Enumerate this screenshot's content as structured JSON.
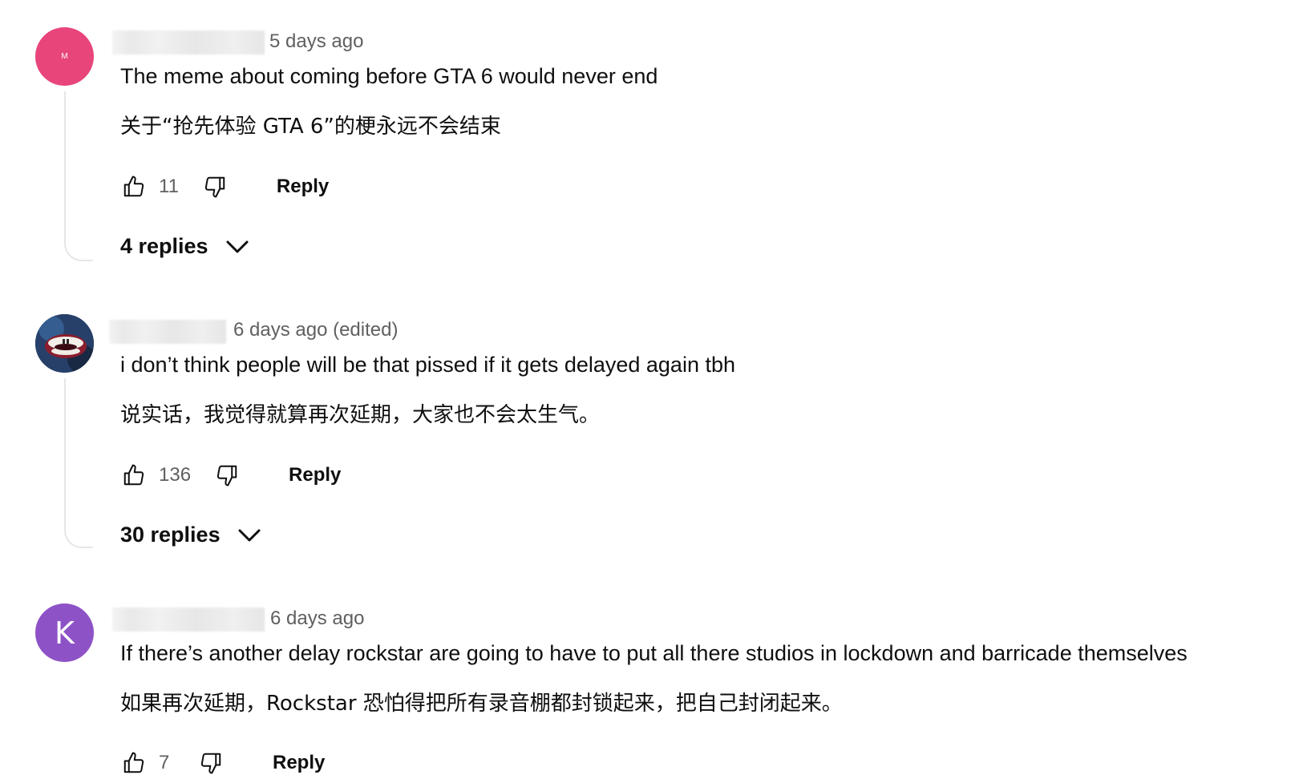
{
  "comments": [
    {
      "avatar_letter": "M",
      "avatar_color": "#e8457b",
      "timestamp": "5 days ago",
      "text": "The meme about coming before GTA 6 would never end",
      "translation": "关于“抢先体验 GTA 6”的梗永远不会结束",
      "likes": "11",
      "reply_label": "Reply",
      "replies_label": "4 replies"
    },
    {
      "avatar_letter": "",
      "avatar_color": "#1f3049",
      "timestamp": "6 days ago (edited)",
      "text": "i don’t think people will be that pissed if it gets delayed again tbh",
      "translation": "说实话，我觉得就算再次延期，大家也不会太生气。",
      "likes": "136",
      "reply_label": "Reply",
      "replies_label": "30 replies"
    },
    {
      "avatar_letter": "K",
      "avatar_color": "#8e52c7",
      "timestamp": "6 days ago",
      "text": "If there’s another delay rockstar are going to have to put all there studios in lockdown and barricade themselves",
      "translation": "如果再次延期，Rockstar 恐怕得把所有录音棚都封锁起来，把自己封闭起来。",
      "likes": "7",
      "reply_label": "Reply"
    }
  ],
  "icons": {
    "like": "thumbs-up-icon",
    "dislike": "thumbs-down-icon",
    "expand": "chevron-down-icon"
  }
}
